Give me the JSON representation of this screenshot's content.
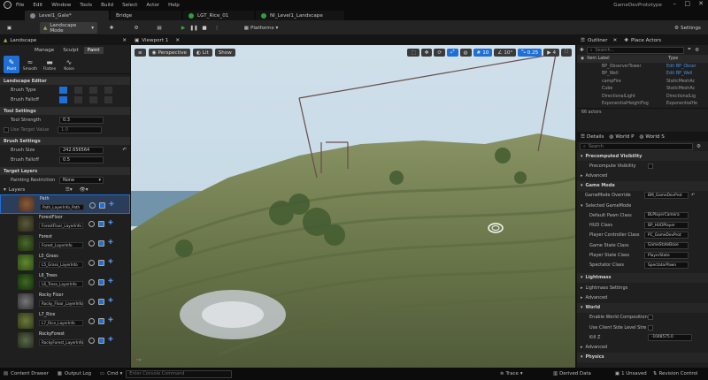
{
  "menu": {
    "items": [
      "File",
      "Edit",
      "Window",
      "Tools",
      "Build",
      "Select",
      "Actor",
      "Help"
    ],
    "project": "GameDevPrototype"
  },
  "tabs": [
    {
      "label": "Level1_Gale*"
    },
    {
      "label": "Bridge"
    },
    {
      "label": "LGT_Rice_01"
    },
    {
      "label": "NI_Level1_Landscape"
    }
  ],
  "toolbar": {
    "mode": "Landscape Mode",
    "platforms": "Platforms",
    "settings": "Settings"
  },
  "landscape_panel": {
    "title": "Landscape",
    "modes": [
      "Manage",
      "Sculpt",
      "Paint"
    ],
    "tools": [
      "Paint",
      "Smooth",
      "Flatten",
      "Noise"
    ],
    "editor_section": "Landscape Editor",
    "brush_type": "Brush Type",
    "brush_falloff": "Brush Falloff",
    "tool_settings": "Tool Settings",
    "tool_strength": "Tool Strength",
    "tool_strength_val": "0.3",
    "use_target_value": "Use Target Value",
    "target_val": "1.0",
    "brush_settings": "Brush Settings",
    "brush_size": "Brush Size",
    "brush_size_val": "242.656564",
    "brush_falloff2": "Brush Falloff",
    "brush_falloff_val": "0.5",
    "target_layers": "Target Layers",
    "painting_restriction": "Painting Restriction",
    "restriction_val": "None",
    "layers_label": "Layers",
    "layers": [
      {
        "name": "Path",
        "dd": "Path_LayerInfo_Path"
      },
      {
        "name": "ForestFloor",
        "dd": "ForestFloor_LayerInfo"
      },
      {
        "name": "Forest",
        "dd": "Forest_LayerInfo"
      },
      {
        "name": "L5_Grass",
        "dd": "L5_Grass_LayerInfo"
      },
      {
        "name": "L6_Trees",
        "dd": "L6_Trees_LayerInfo"
      },
      {
        "name": "Rocky Floor",
        "dd": "Rocky_Floor_LayerInfo"
      },
      {
        "name": "L7_Rice",
        "dd": "L7_Rice_LayerInfo"
      },
      {
        "name": "RockyForest",
        "dd": "RockyForest_LayerInfo"
      }
    ]
  },
  "viewport": {
    "tab": "Viewport 1",
    "perspective": "Perspective",
    "lit": "Lit",
    "show": "Show",
    "snap1": "10",
    "snap2": "10°",
    "snap3": "0.25",
    "cam": "4"
  },
  "outliner": {
    "title": "Outliner",
    "place": "Place Actors",
    "search": "Search...",
    "col_label": "Item Label",
    "col_type": "Type",
    "rows": [
      {
        "label": "BP_ObserverTower",
        "type": "Edit BP_Obser"
      },
      {
        "label": "BP_Well",
        "type": "Edit BP_Well"
      },
      {
        "label": "campFire",
        "type": "StaticMeshAc"
      },
      {
        "label": "Cube",
        "type": "StaticMeshAc"
      },
      {
        "label": "DirectionalLight",
        "type": "DirectionalLig"
      },
      {
        "label": "ExponentialHeightFog",
        "type": "ExponentialHe"
      }
    ],
    "count": "66 actors"
  },
  "details": {
    "tabs": [
      "Details",
      "World P",
      "World S"
    ],
    "search": "Search",
    "sections": {
      "precomputed": "Precomputed Visibility",
      "precomputed_vis": "Precompute Visibility",
      "advanced": "Advanced",
      "game_mode": "Game Mode",
      "gm_override": "GameMode Override",
      "gm_override_val": "BM_GameDevProt",
      "selected": "Selected GameMode",
      "props": [
        {
          "label": "Default Pawn Class",
          "val": "BLPlayerCamera"
        },
        {
          "label": "HUD Class",
          "val": "BP_HUDPlayer"
        },
        {
          "label": "Player Controller Class",
          "val": "PC_GameDevProt"
        },
        {
          "label": "Game State Class",
          "val": "GameStateBase"
        },
        {
          "label": "Player State Class",
          "val": "PlayerState"
        },
        {
          "label": "Spectator Class",
          "val": "SpectatorPawn"
        }
      ],
      "lightmass": "Lightmass",
      "lightmass_settings": "Lightmass Settings",
      "advanced2": "Advanced",
      "world": "World",
      "enable_world_comp": "Enable World Composition",
      "use_client": "Use Client Side Level Stre",
      "kill_z": "Kill Z",
      "kill_z_val": "-1048575.0",
      "advanced3": "Advanced",
      "physics": "Physics"
    }
  },
  "status": {
    "content_drawer": "Content Drawer",
    "output_log": "Output Log",
    "cmd": "Cmd",
    "console": "Enter Console Command",
    "trace": "Trace",
    "derived": "Derived Data",
    "unsaved": "1 Unsaved",
    "revision": "Revision Control"
  },
  "colors": {
    "accent": "#1f6fd6",
    "bg": "#1f1f1f",
    "panel_dark": "#151515",
    "sky": "#c7dce9",
    "terrain": "#63703f"
  }
}
